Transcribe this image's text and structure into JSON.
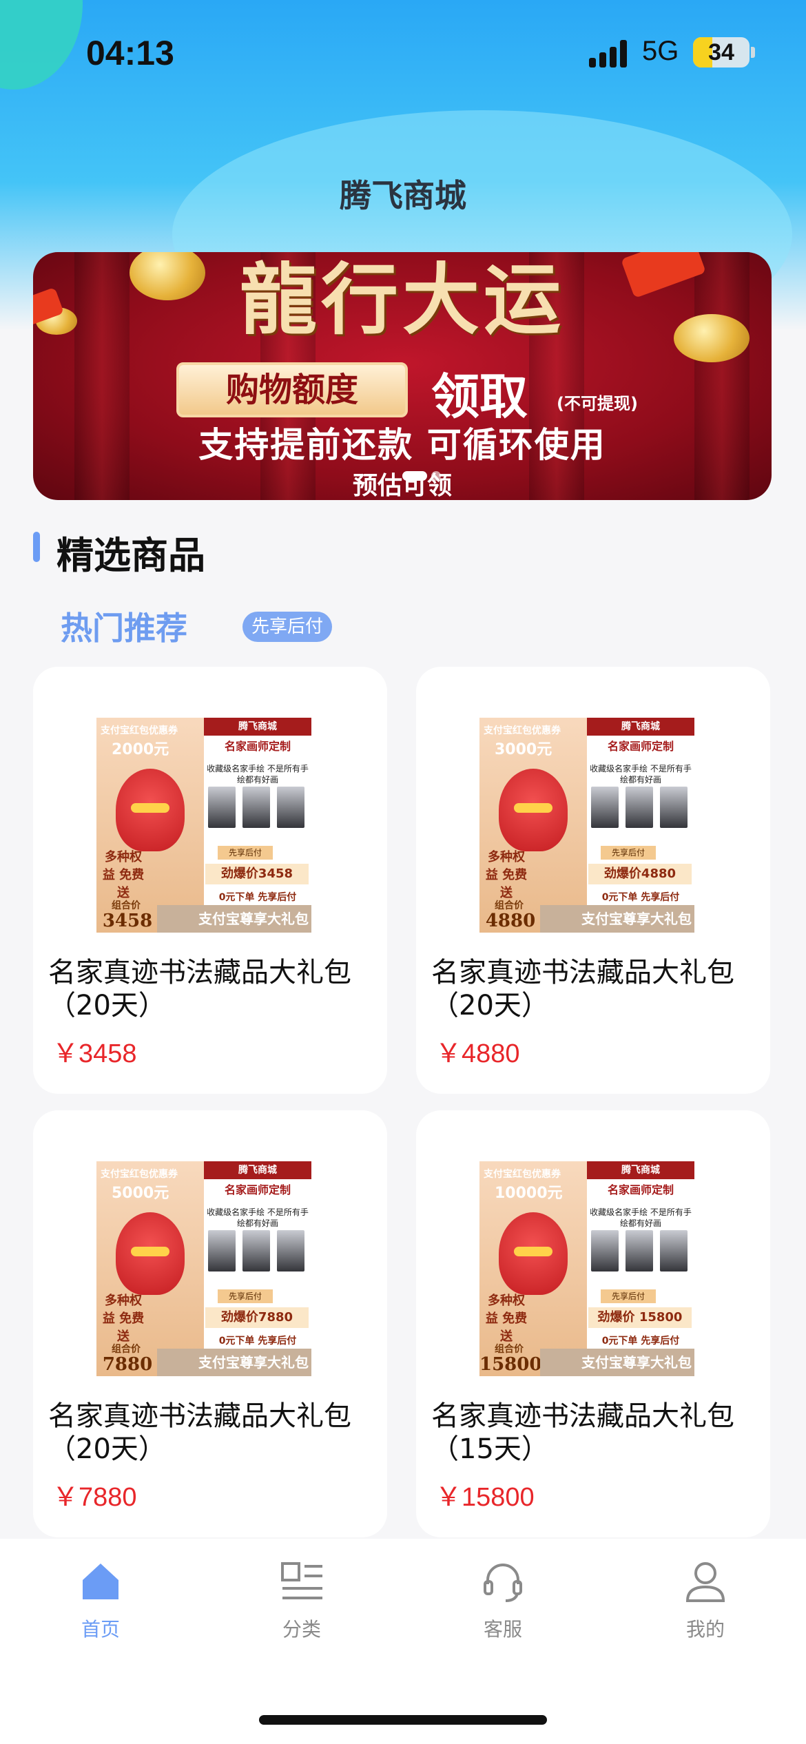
{
  "status": {
    "time": "04:13",
    "network": "5G",
    "battery": "34",
    "battery_level": 0.34
  },
  "app": {
    "title": "腾飞商城"
  },
  "banner": {
    "headline": "龍行大运",
    "quota": "购物额度",
    "claim": "领取",
    "no_cash": "(不可提现)",
    "support": "支持提前还款 可循环使用",
    "estimate": "预估可领",
    "slide_count": 2,
    "active_slide": 0
  },
  "section": {
    "title": "精选商品"
  },
  "hot": {
    "title": "热门推荐",
    "badge": "先享后付"
  },
  "products": [
    {
      "name": "名家真迹书法藏品大礼包（20天）",
      "price": "￥3458",
      "thumb": {
        "coupon": "支付宝红包优惠券",
        "amount": "2000元",
        "perk": "多种权益 免费送",
        "combo": "组合价",
        "combo_price": "3458",
        "shop": "腾飞商城",
        "master": "名家画师定制",
        "collect": "收藏级名家手绘 不是所有手绘都有好画",
        "tag": "先享后付",
        "hot_price": "劲爆价3458",
        "zero": "0元下单 先享后付",
        "strip": "支付宝尊享大礼包"
      }
    },
    {
      "name": "名家真迹书法藏品大礼包（20天）",
      "price": "￥4880",
      "thumb": {
        "coupon": "支付宝红包优惠券",
        "amount": "3000元",
        "perk": "多种权益 免费送",
        "combo": "组合价",
        "combo_price": "4880",
        "shop": "腾飞商城",
        "master": "名家画师定制",
        "collect": "收藏级名家手绘 不是所有手绘都有好画",
        "tag": "先享后付",
        "hot_price": "劲爆价4880",
        "zero": "0元下单 先享后付",
        "strip": "支付宝尊享大礼包"
      }
    },
    {
      "name": "名家真迹书法藏品大礼包（20天）",
      "price": "￥7880",
      "thumb": {
        "coupon": "支付宝红包优惠券",
        "amount": "5000元",
        "perk": "多种权益 免费送",
        "combo": "组合价",
        "combo_price": "7880",
        "shop": "腾飞商城",
        "master": "名家画师定制",
        "collect": "收藏级名家手绘 不是所有手绘都有好画",
        "tag": "先享后付",
        "hot_price": "劲爆价7880",
        "zero": "0元下单 先享后付",
        "strip": "支付宝尊享大礼包"
      }
    },
    {
      "name": "名家真迹书法藏品大礼包（15天）",
      "price": "￥15800",
      "thumb": {
        "coupon": "支付宝红包优惠券",
        "amount": "10000元",
        "perk": "多种权益 免费送",
        "combo": "组合价",
        "combo_price": "15800",
        "shop": "腾飞商城",
        "master": "名家画师定制",
        "collect": "收藏级名家手绘 不是所有手绘都有好画",
        "tag": "先享后付",
        "hot_price": "劲爆价 15800",
        "zero": "0元下单 先享后付",
        "strip": "支付宝尊享大礼包"
      }
    }
  ],
  "tabs": [
    {
      "label": "首页",
      "icon": "home-icon"
    },
    {
      "label": "分类",
      "icon": "category-icon"
    },
    {
      "label": "客服",
      "icon": "headset-icon"
    },
    {
      "label": "我的",
      "icon": "user-icon"
    }
  ],
  "colors": {
    "accent": "#6b9cf5",
    "price": "#e8262a",
    "banner_red": "#c0162b"
  }
}
